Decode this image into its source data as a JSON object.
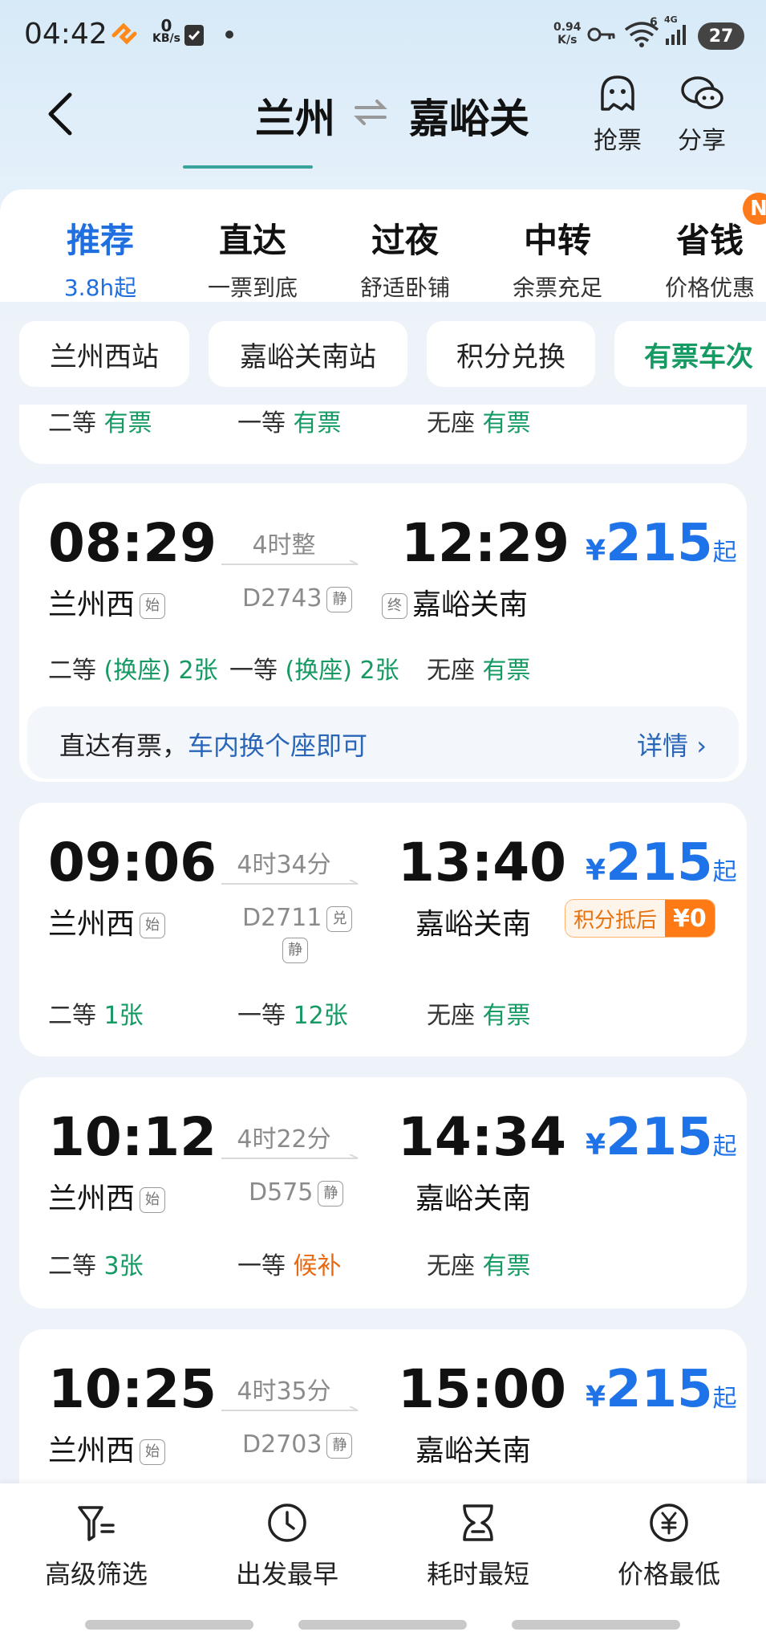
{
  "status": {
    "time": "04:42",
    "net_speed": "0",
    "net_unit": "KB/s",
    "speed2": "0.94",
    "speed2_unit": "K/s",
    "wifi_num": "6",
    "signal_label": "4G",
    "battery": "27"
  },
  "header": {
    "from": "兰州",
    "to": "嘉峪关",
    "grab_label": "抢票",
    "share_label": "分享"
  },
  "tabs": [
    {
      "title": "推荐",
      "sub": "3.8h起"
    },
    {
      "title": "直达",
      "sub": "一票到底"
    },
    {
      "title": "过夜",
      "sub": "舒适卧铺"
    },
    {
      "title": "中转",
      "sub": "余票充足"
    },
    {
      "title": "省钱",
      "sub": "价格优惠"
    }
  ],
  "new_badge": "N",
  "chips": [
    "兰州西站",
    "嘉峪关南站",
    "积分兑换",
    "有票车次"
  ],
  "partial_row": {
    "second": "二等",
    "second_v": "有票",
    "first": "一等",
    "first_v": "有票",
    "none": "无座",
    "none_v": "有票"
  },
  "trains": [
    {
      "dep": "08:29",
      "arr": "12:29",
      "from": "兰州西",
      "to": "嘉峪关南",
      "from_mark": "始",
      "to_mark": "终",
      "duration": "4时整",
      "code": "D2743",
      "code_mark": "静",
      "yen": "¥",
      "price": "215",
      "qi": "起",
      "second": "二等",
      "second_v": "(换座) 2张",
      "first": "一等",
      "first_v": "(换座) 2张",
      "none": "无座",
      "none_v": "有票",
      "tip_a": "直达有票，",
      "tip_b": "车内换个座即可",
      "tip_more": "详情 ›"
    },
    {
      "dep": "09:06",
      "arr": "13:40",
      "from": "兰州西",
      "to": "嘉峪关南",
      "from_mark": "始",
      "duration": "4时34分",
      "code": "D2711",
      "code_mark": "兑",
      "code_mark2": "静",
      "yen": "¥",
      "price": "215",
      "qi": "起",
      "points_label": "积分抵后",
      "points_value": "¥0",
      "second": "二等",
      "second_v": "1张",
      "first": "一等",
      "first_v": "12张",
      "none": "无座",
      "none_v": "有票"
    },
    {
      "dep": "10:12",
      "arr": "14:34",
      "from": "兰州西",
      "to": "嘉峪关南",
      "from_mark": "始",
      "duration": "4时22分",
      "code": "D575",
      "code_mark": "静",
      "yen": "¥",
      "price": "215",
      "qi": "起",
      "second": "二等",
      "second_v": "3张",
      "first": "一等",
      "first_v": "候补",
      "none": "无座",
      "none_v": "有票"
    },
    {
      "dep": "10:25",
      "arr": "15:00",
      "from": "兰州西",
      "to": "嘉峪关南",
      "from_mark": "始",
      "duration": "4时35分",
      "code": "D2703",
      "code_mark": "静",
      "yen": "¥",
      "price": "215",
      "qi": "起"
    }
  ],
  "bottom": [
    "高级筛选",
    "出发最早",
    "耗时最短",
    "价格最低"
  ],
  "colors": {
    "accent": "#1f73e8",
    "green": "#149a62",
    "orange": "#e86a12"
  }
}
